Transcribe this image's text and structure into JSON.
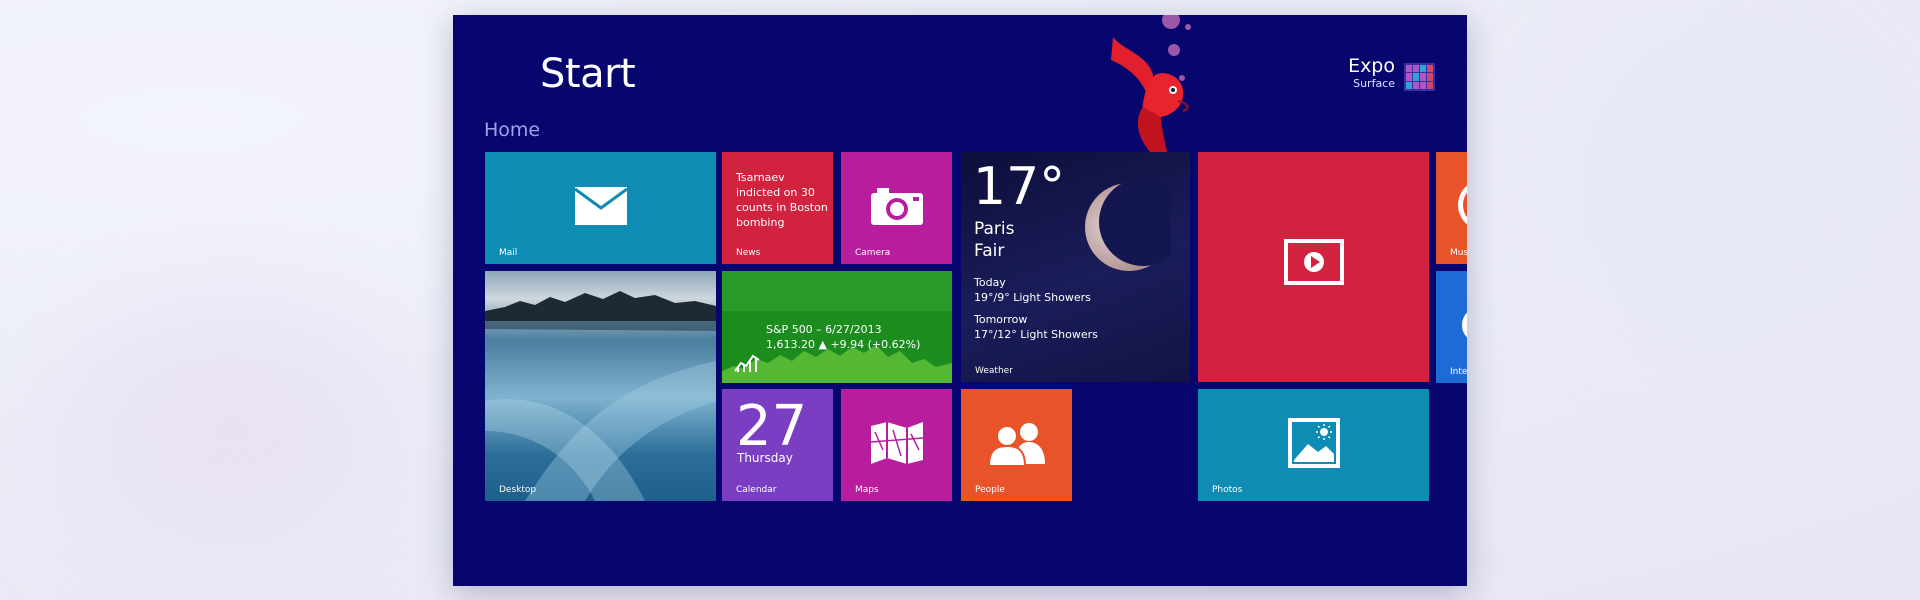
{
  "start": {
    "title": "Start",
    "group": "Home"
  },
  "user": {
    "name": "Expo",
    "subtitle": "Surface"
  },
  "tiles": {
    "mail": {
      "label": "Mail",
      "color": "#0f8cb4"
    },
    "news": {
      "label": "News",
      "headline": "Tsarnaev indicted on 30 counts in Boston bombing",
      "color": "#d1223f"
    },
    "camera": {
      "label": "Camera",
      "color": "#b81d9d"
    },
    "weather": {
      "label": "Weather",
      "temp": "17°",
      "city": "Paris",
      "condition": "Fair",
      "today_label": "Today",
      "today_forecast": "19°/9° Light Showers",
      "tomorrow_label": "Tomorrow",
      "tomorrow_forecast": "17°/12° Light Showers"
    },
    "video": {
      "color": "#d1223f"
    },
    "desktop": {
      "label": "Desktop"
    },
    "finance": {
      "line1": "S&P 500 – 6/27/2013",
      "line2": "1,613.20 ▲ +9.94 (+0.62%)",
      "color": "#1c8c1f"
    },
    "calendar": {
      "label": "Calendar",
      "day": "27",
      "weekday": "Thursday",
      "color": "#7a3ec2"
    },
    "maps": {
      "label": "Maps",
      "color": "#b81d9d"
    },
    "people": {
      "label": "People",
      "color": "#e9532a"
    },
    "photos": {
      "label": "Photos",
      "color": "#0f8cb4"
    },
    "music": {
      "label": "Mus",
      "color": "#e9532a"
    },
    "ie": {
      "label": "Inter",
      "color": "#1d6bd6"
    }
  },
  "icons": {
    "mail": "mail-icon",
    "camera": "camera-icon",
    "video": "video-play-icon",
    "maps": "map-icon",
    "people": "people-icon",
    "photos": "photo-icon",
    "finance": "finance-chart-icon"
  }
}
